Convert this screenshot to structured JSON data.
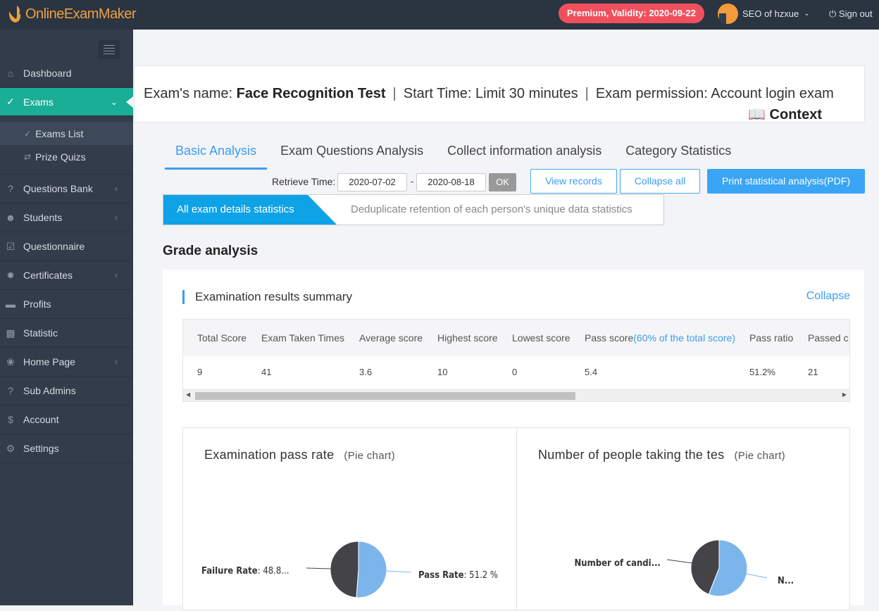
{
  "brand": "OnlineExamMaker",
  "topbar": {
    "premium": "Premium, Validity: 2020-09-22",
    "user": "SEO of hzxue",
    "signout": "Sign out"
  },
  "sidebar": {
    "items": [
      {
        "label": "Dashboard",
        "icon": "home-icon"
      },
      {
        "label": "Exams",
        "icon": "check-circle-icon",
        "active": true
      },
      {
        "label": "Questions Bank",
        "icon": "question-icon"
      },
      {
        "label": "Students",
        "icon": "users-icon"
      },
      {
        "label": "Questionnaire",
        "icon": "checkbox-icon"
      },
      {
        "label": "Certificates",
        "icon": "cert-icon"
      },
      {
        "label": "Profits",
        "icon": "card-icon"
      },
      {
        "label": "Statistic",
        "icon": "bar-chart-icon"
      },
      {
        "label": "Home Page",
        "icon": "leaf-icon"
      },
      {
        "label": "Sub Admins",
        "icon": "question-icon"
      },
      {
        "label": "Account",
        "icon": "dollar-icon"
      },
      {
        "label": "Settings",
        "icon": "gear-icon"
      }
    ],
    "sub": [
      "Exams List",
      "Prize Quizs"
    ]
  },
  "header": {
    "name_label": "Exam's name:",
    "name": "Face Recognition Test",
    "start": "Start Time: Limit 30 minutes",
    "permission": "Exam permission: Account login exam",
    "context": "Context"
  },
  "tabs": [
    "Basic Analysis",
    "Exam Questions Analysis",
    "Collect information analysis",
    "Category Statistics"
  ],
  "filter": {
    "label": "Retrieve Time:",
    "from": "2020-07-02",
    "to": "2020-08-18",
    "sep": "-",
    "ok": "OK"
  },
  "buttons": {
    "view": "View records",
    "collapse_all": "Collapse all",
    "print": "Print statistical analysis(PDF)"
  },
  "stat_tabs": [
    "All exam details statistics",
    "Deduplicate retention of each person's unique data statistics"
  ],
  "grade_title": "Grade analysis",
  "summary": {
    "title": "Examination results summary",
    "collapse": "Collapse",
    "headers": [
      "Total Score",
      "Exam Taken Times",
      "Average score",
      "Highest score",
      "Lowest score",
      "Pass score",
      "Pass ratio",
      "Passed c"
    ],
    "pass_note": "(60% of the total score)",
    "values": [
      "9",
      "41",
      "3.6",
      "10",
      "0",
      "5.4",
      "51.2%",
      "21"
    ]
  },
  "chart_data": [
    {
      "type": "pie",
      "title": "Examination pass rate",
      "subtitle": "(Pie chart)",
      "colors": [
        "#7cb5ec",
        "#434348"
      ],
      "slices": [
        {
          "label": "Pass Rate",
          "value": 51.2,
          "text": ": 51.2 %"
        },
        {
          "label": "Failure Rate",
          "value": 48.8,
          "text": ": 48.8..."
        }
      ]
    },
    {
      "type": "pie",
      "title": "Number of people taking the tes",
      "subtitle": "(Pie chart)",
      "colors": [
        "#7cb5ec",
        "#434348"
      ],
      "slices": [
        {
          "label": "N...",
          "value": 56,
          "text": ""
        },
        {
          "label": "Number of candi...",
          "value": 44,
          "text": ""
        }
      ]
    }
  ]
}
